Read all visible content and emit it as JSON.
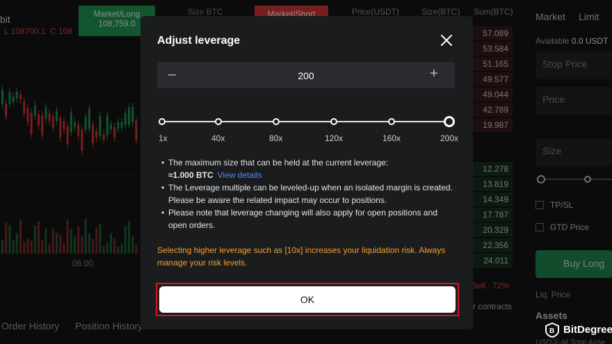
{
  "background": {
    "symbol_fragment": "bit",
    "price_low": "L 108700.1",
    "price_c": "C 108",
    "market_long": {
      "label": "Market/Long",
      "price": "108,759.0"
    },
    "size_header": "Size BTC",
    "market_short": {
      "label": "Market/Short"
    },
    "orderbook": {
      "headers": [
        "Price(USDT)",
        "Size(BTC)",
        "Sum(BTC)"
      ],
      "asks": [
        "57.089",
        "53.584",
        "51.165",
        "49.577",
        "49.044",
        "42.789",
        "19.987"
      ],
      "bids": [
        "12.278",
        "13.819",
        "14.349",
        "17.787",
        "20.329",
        "22.356",
        "24.011"
      ],
      "sell_ratio": "Sell : 72%",
      "contracts": "r contracts"
    },
    "time_label": "06:00",
    "right_panel": {
      "tabs": [
        "Market",
        "Limit"
      ],
      "available": "Available",
      "available_value": "0.0 USDT",
      "stop_price": "Stop Price",
      "price": "Price",
      "size": "Size",
      "tpsl": "TP/SL",
      "gtd": "GTD Price",
      "buy_long": "Buy Long",
      "liq_price": "Liq. Price",
      "assets": "Assets",
      "total_assets": "USDⓈ-M Total Asse"
    },
    "bottom_tabs": [
      "Order History",
      "Position History"
    ]
  },
  "modal": {
    "title": "Adjust leverage",
    "stepper": {
      "minus": "–",
      "value": "200",
      "plus": "+"
    },
    "slider": {
      "ticks": [
        "1x",
        "40x",
        "80x",
        "120x",
        "160x",
        "200x"
      ],
      "selected": "200x"
    },
    "notes": [
      {
        "text": "The maximum size that can be held at the current leverage:",
        "strong": "≈1.000 BTC",
        "link": "View details"
      },
      {
        "text": "The Leverage multiple can be leveled-up when an isolated margin is created. Please be aware the related impact may occur to positions."
      },
      {
        "text": "Please note that leverage changing will also apply for open positions and open orders."
      }
    ],
    "warning": "Selecting higher leverage such as [10x] increases your liquidation risk. Always manage your risk levels.",
    "ok_label": "OK"
  },
  "watermark": {
    "text": "BitDegree"
  },
  "colors": {
    "accent_green": "#1f9d55",
    "accent_red": "#d93a3a",
    "warning": "#f0a033",
    "link": "#4a8df6",
    "highlight": "#d4141f"
  }
}
